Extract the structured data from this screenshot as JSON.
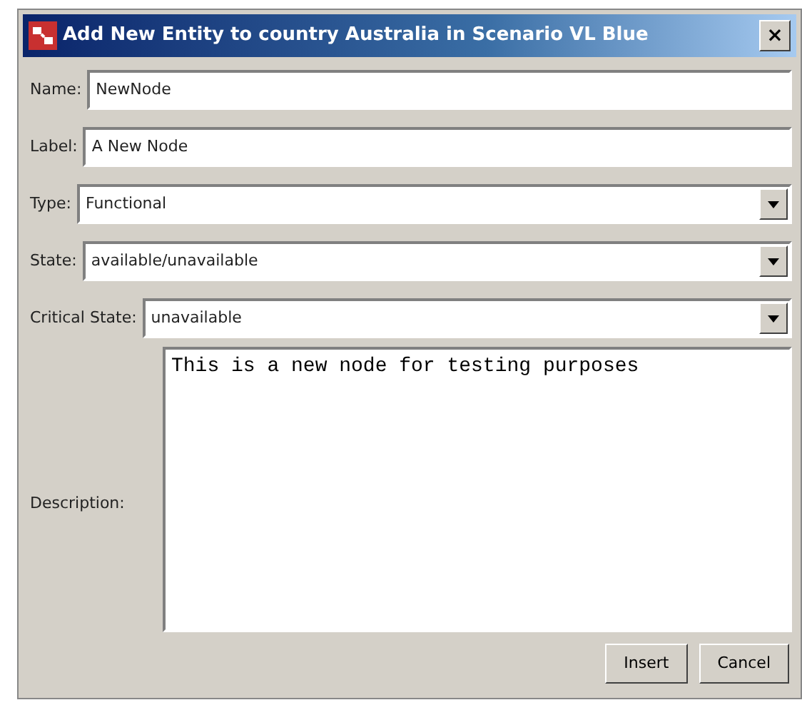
{
  "window": {
    "title": "Add New Entity to country Australia in Scenario VL Blue",
    "close": "×"
  },
  "fields": [
    {
      "kind": "text",
      "label": "Name:",
      "value": "NewNode"
    },
    {
      "kind": "text",
      "label": "Label:",
      "value": "A New Node"
    },
    {
      "kind": "combo",
      "label": "Type:",
      "value": "Functional"
    },
    {
      "kind": "combo",
      "label": "State:",
      "value": "available/unavailable"
    },
    {
      "kind": "combo",
      "label": "Critical State:",
      "value": "unavailable"
    }
  ],
  "description": {
    "label": "Description:",
    "value": "This is a new node for testing purposes"
  },
  "buttons": [
    "Insert",
    "Cancel"
  ]
}
